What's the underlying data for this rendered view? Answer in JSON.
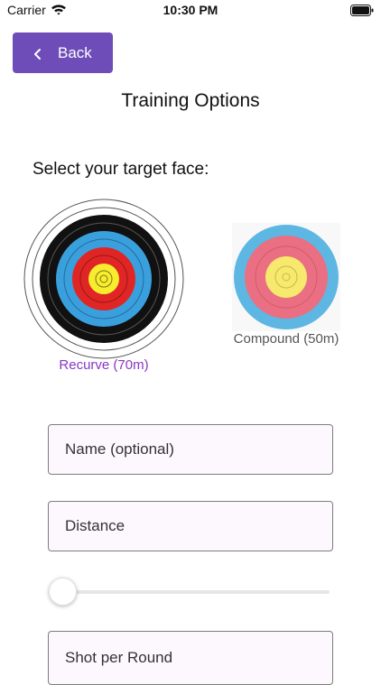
{
  "status_bar": {
    "carrier": "Carrier",
    "time": "10:30 PM",
    "wifi_icon": "wifi-icon",
    "battery_icon": "battery-icon"
  },
  "header": {
    "back_label": "Back",
    "title": "Training Options"
  },
  "target_section": {
    "prompt": "Select your target face:",
    "options": [
      {
        "label": "Recurve (70m)",
        "selected": true,
        "color": "#8a35c6",
        "icon": "recurve-target-face-icon"
      },
      {
        "label": "Compound (50m)",
        "selected": false,
        "color": "#555555",
        "icon": "compound-target-face-icon"
      }
    ]
  },
  "form": {
    "name_placeholder": "Name (optional)",
    "distance_placeholder": "Distance",
    "shots_placeholder": "Shot per Round",
    "slider_value": 0
  },
  "colors": {
    "accent": "#6e4db9",
    "field_background": "#fdf8fd"
  }
}
